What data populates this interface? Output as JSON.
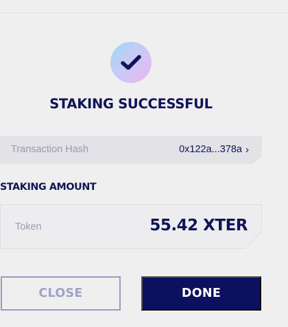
{
  "modal": {
    "title": "STAKING SUCCESSFUL",
    "transaction": {
      "label": "Transaction Hash",
      "hash": "0x122a...378a"
    },
    "staking_amount": {
      "section_label": "STAKING AMOUNT",
      "token_label": "Token",
      "value": "55.42 XTER"
    },
    "buttons": {
      "close_label": "CLOSE",
      "done_label": "DONE"
    }
  },
  "colors": {
    "primary": "#101457",
    "button_primary": "#0d105e",
    "muted_text": "#9a9ab4",
    "outline_button": "#9a9ac2",
    "background": "#efefef",
    "badge_gradient": [
      "#9fdaf4",
      "#c8c9f6",
      "#ecb7ef"
    ]
  },
  "icons": {
    "success": "checkmark-icon",
    "hash_link": "chevron-right-icon"
  }
}
